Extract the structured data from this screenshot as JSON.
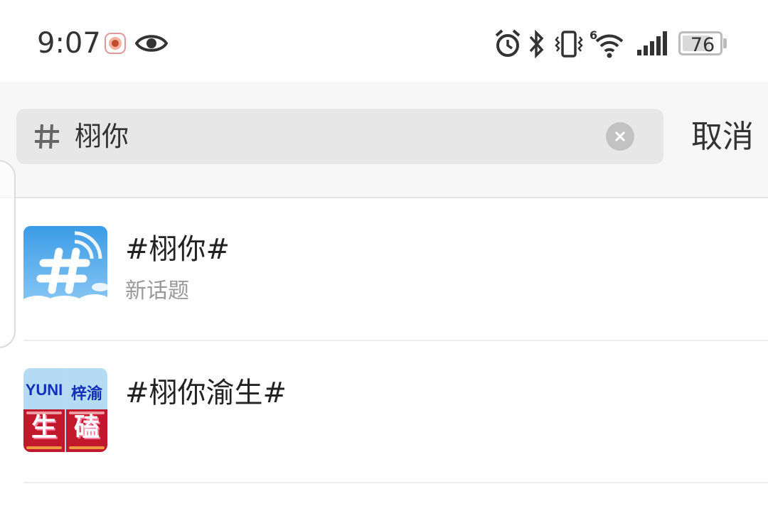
{
  "status_bar": {
    "time": "9:07",
    "battery": "76",
    "battery_level_percent": 76,
    "icons": [
      "notification-app-icon",
      "eye-icon",
      "alarm-icon",
      "bluetooth-icon",
      "vibrate-icon",
      "wifi-icon",
      "signal-icon",
      "battery-icon"
    ],
    "wifi_badge": "6"
  },
  "search": {
    "query": "栩你",
    "cancel_label": "取消",
    "icon": "hash-icon"
  },
  "results": [
    {
      "title": "#栩你#",
      "subtitle": "新话题",
      "thumb": "hashtag-cloud-thumbnail"
    },
    {
      "title": "#栩你渝生#",
      "thumb": "yuni-poster-thumbnail",
      "thumb_text_left": "YUNI",
      "thumb_text_right": "梓渝",
      "thumb_big_left": "生",
      "thumb_big_right": "磕"
    }
  ],
  "colors": {
    "background": "#ffffff",
    "search_area": "#f7f7f7",
    "search_box": "#e7e7e7",
    "thumb_blue": "#39a0e8",
    "poster_red": "#c1192b",
    "poster_blue_text": "#1230b8"
  }
}
